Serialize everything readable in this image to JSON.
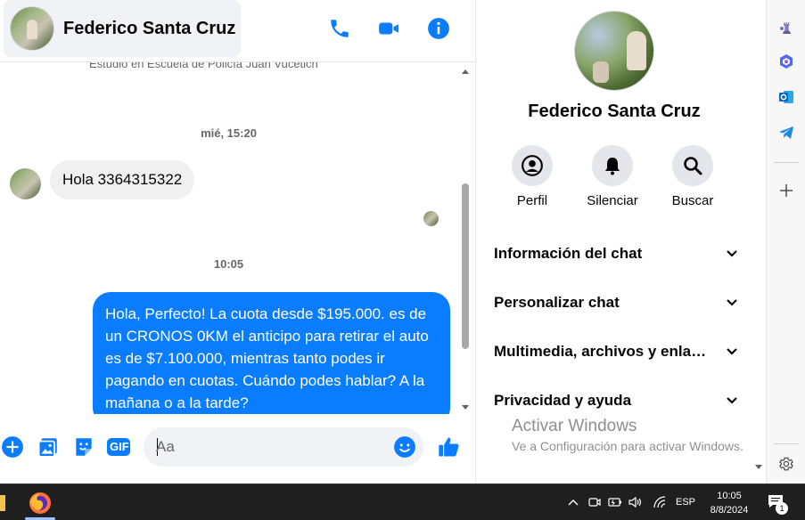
{
  "header": {
    "contact_name": "Federico Santa Cruz",
    "icons": [
      "phone-icon",
      "video-camera-icon",
      "info-icon"
    ]
  },
  "messages": {
    "truncated_info": "Estudió en Escuela de Policía Juan Vucetich",
    "timestamp_1": "mié, 15:20",
    "incoming_text": "Hola 3364315322",
    "timestamp_2": "10:05",
    "outgoing_text": "Hola, Perfecto! La cuota desde $195.000. es de un CRONOS 0KM el anticipo para retirar el auto es de $7.100.000, mientras tanto podes ir pagando en cuotas. Cuándo podes hablar? A la mañana o a la tarde?"
  },
  "composer": {
    "placeholder": "Aa",
    "gif_label": "GIF",
    "icons": [
      "plus-icon",
      "photo-icon",
      "sticker-icon",
      "gif-icon",
      "emoji-icon",
      "thumbs-up-icon"
    ]
  },
  "info_panel": {
    "name": "Federico Santa Cruz",
    "actions": [
      {
        "label": "Perfil",
        "icon": "profile-icon"
      },
      {
        "label": "Silenciar",
        "icon": "bell-icon"
      },
      {
        "label": "Buscar",
        "icon": "search-icon"
      }
    ],
    "sections": [
      {
        "label": "Información del chat"
      },
      {
        "label": "Personalizar chat"
      },
      {
        "label": "Multimedia, archivos y enlaces"
      },
      {
        "label": "Privacidad y ayuda"
      }
    ],
    "watermark_title": "Activar Windows",
    "watermark_subtitle": "Ve a Configuración para activar Windows."
  },
  "edge_sidebar": {
    "icons": [
      "chess-icon",
      "copilot-icon",
      "outlook-icon",
      "telegram-icon",
      "add-icon",
      "settings-icon"
    ]
  },
  "taskbar": {
    "language": "ESP",
    "time": "10:05",
    "date": "8/8/2024",
    "notification_count": "1"
  },
  "colors": {
    "messenger_blue": "#0a7cff",
    "bubble_gray": "#f0f0f0",
    "taskbar": "#1f1f1f"
  }
}
